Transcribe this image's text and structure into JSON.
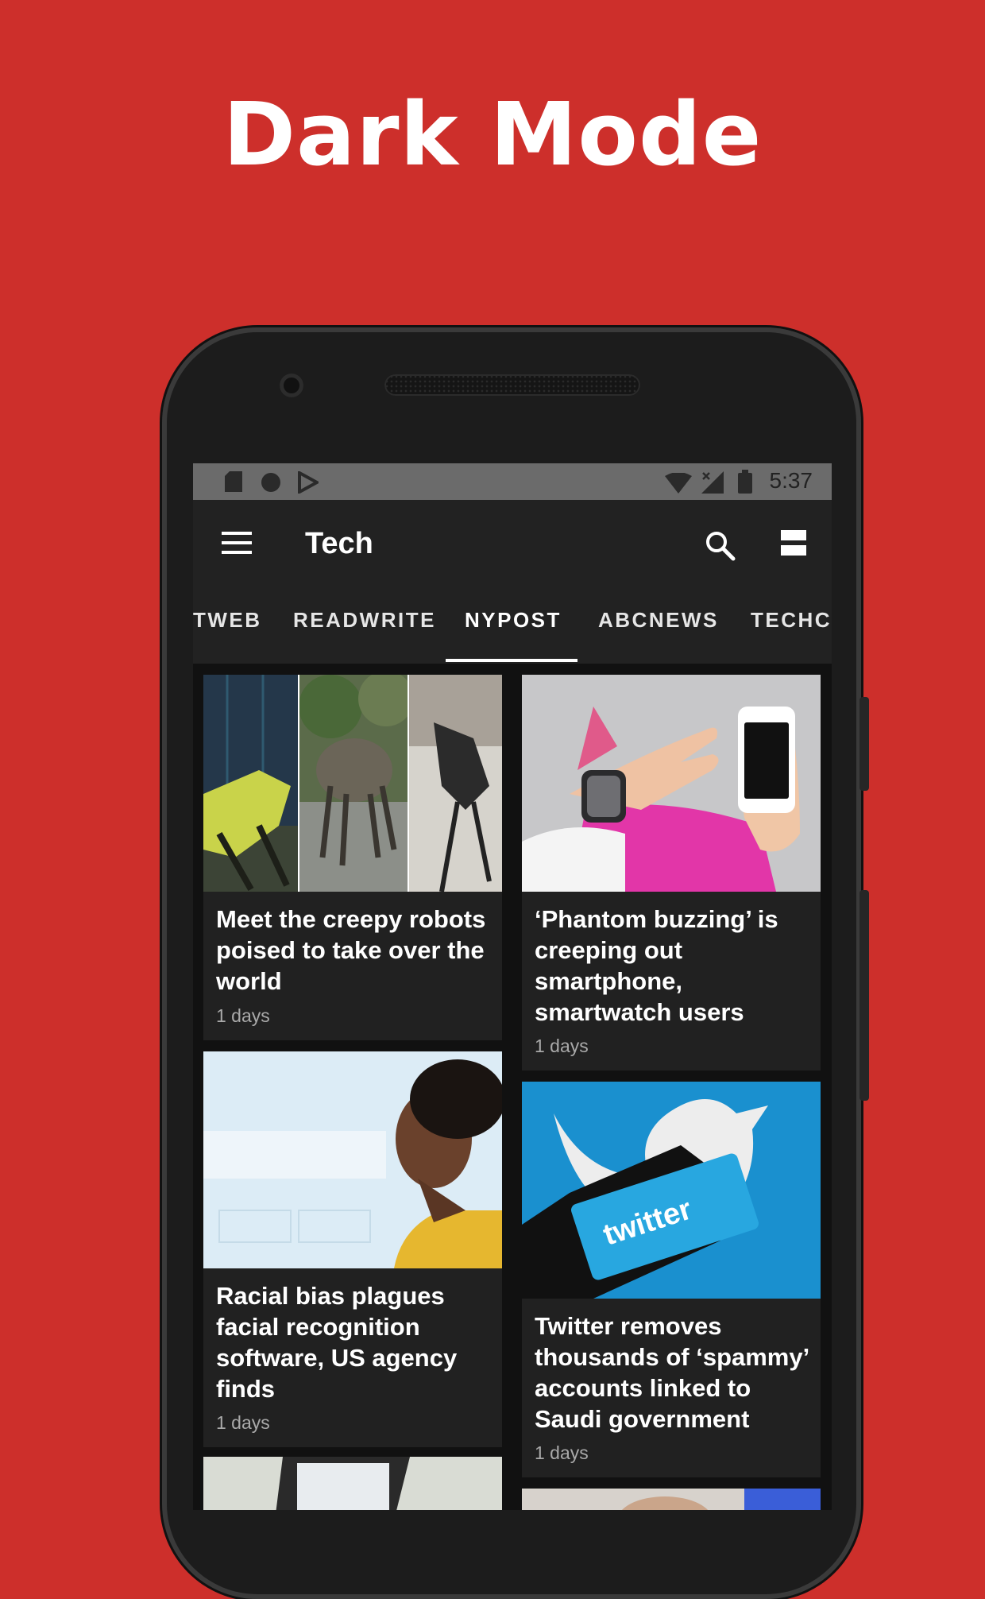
{
  "promo": {
    "title": "Dark Mode"
  },
  "status_bar": {
    "time": "5:37",
    "icons": [
      "sd-card-icon",
      "circle-icon",
      "play-store-icon",
      "wifi-icon",
      "signal-icon",
      "battery-icon"
    ]
  },
  "app_bar": {
    "title": "Tech",
    "icons": [
      "menu-icon",
      "search-icon",
      "view-toggle-icon"
    ]
  },
  "tabs": {
    "items": [
      {
        "label": "TWEB"
      },
      {
        "label": "READWRITE"
      },
      {
        "label": "NYPOST"
      },
      {
        "label": "ABCNEWS"
      },
      {
        "label": "TECHCI"
      }
    ],
    "selected": "NYPOST"
  },
  "articles": [
    {
      "title": "Meet the creepy robots poised to take over the world",
      "age": "1 days"
    },
    {
      "title": "‘Phantom buzzing’ is creeping out smartphone, smartwatch users",
      "age": "1 days"
    },
    {
      "title": "Racial bias plagues facial recognition software, US agency finds",
      "age": "1 days"
    },
    {
      "title": "Twitter removes thousands of ‘spammy’ accounts linked to Saudi government",
      "age": "1 days"
    }
  ],
  "image_text": {
    "twitter_screen": "twitter"
  },
  "colors": {
    "background": "#cd2f2b",
    "app_bar": "#222222",
    "card": "#212121",
    "screen": "#111111",
    "status_bar": "#6b6b6b"
  }
}
